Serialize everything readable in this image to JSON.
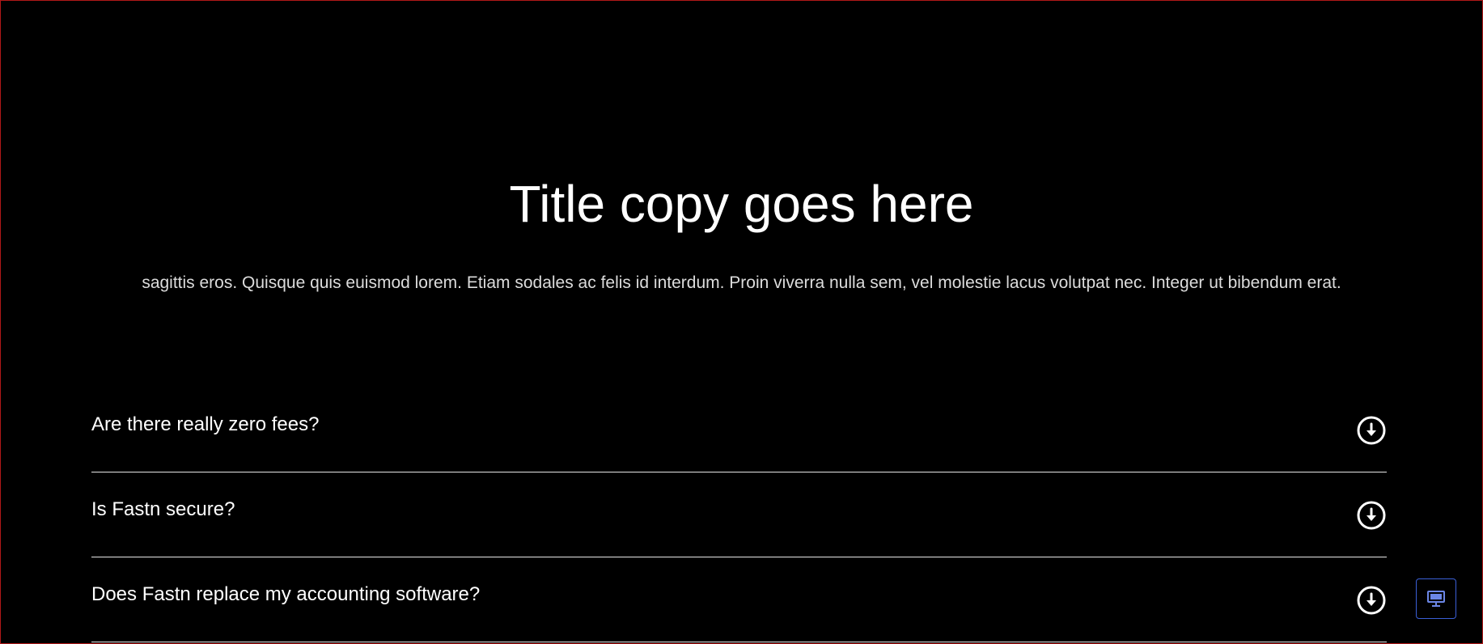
{
  "hero": {
    "title": "Title copy goes here",
    "body": "sagittis eros. Quisque quis euismod lorem. Etiam sodales ac felis id interdum. Proin viverra nulla sem, vel molestie lacus volutpat nec. Integer ut bibendum erat."
  },
  "faq": {
    "items": [
      {
        "question": "Are there really zero fees?",
        "icon": "arrow-down-circle-icon"
      },
      {
        "question": "Is Fastn secure?",
        "icon": "arrow-down-circle-icon"
      },
      {
        "question": "Does Fastn replace my accounting software?",
        "icon": "arrow-down-circle-icon"
      }
    ]
  },
  "device_switch": {
    "icon": "desktop-monitor-icon",
    "accent": "#3a5fd6"
  },
  "colors": {
    "background": "#000000",
    "text": "#ffffff",
    "divider": "#e6e6e6",
    "frame_border": "#b01818"
  }
}
